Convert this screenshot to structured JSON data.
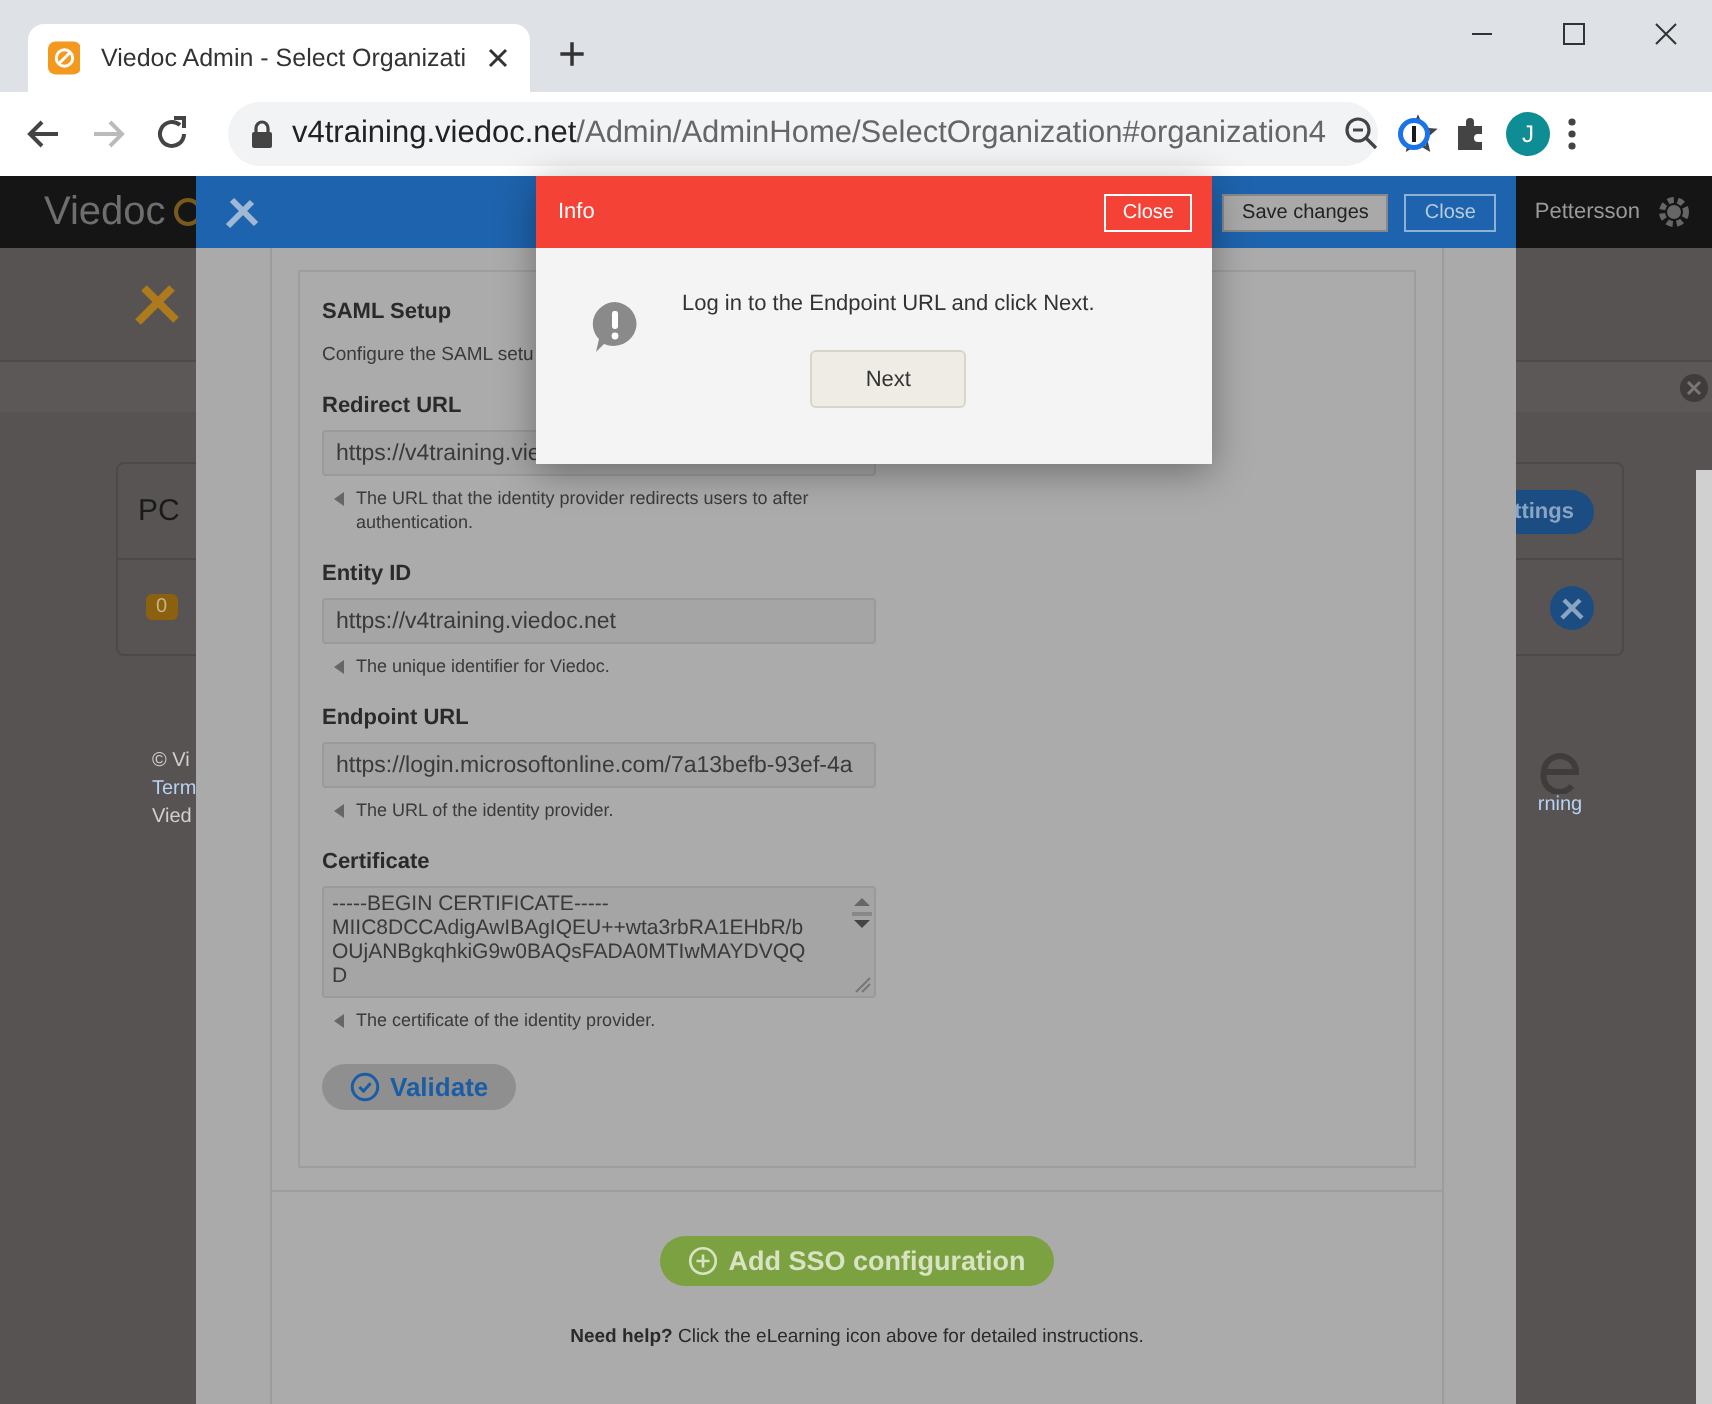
{
  "browser": {
    "tab_title": "Viedoc Admin - Select Organizati",
    "new_tab": "+",
    "url_host": "v4training.viedoc.net",
    "url_path": "/Admin/AdminHome/SelectOrganization#organization4",
    "profile_initial": "J"
  },
  "app_bar": {
    "logo": "Viedoc",
    "user": "Pettersson"
  },
  "background": {
    "card_title": "PC",
    "badge": "0",
    "settings_button": "ttings",
    "footer_lines": [
      "© Vi",
      "Term",
      "Vied"
    ],
    "elearning_link": "rning"
  },
  "settings_modal": {
    "buttons": [
      {
        "label": "Save changes",
        "kind": "secondary"
      },
      {
        "label": "Close",
        "kind": "primary"
      }
    ],
    "section_title": "SAML Setup",
    "section_hint": "Configure the SAML setu",
    "fields": [
      {
        "label": "Redirect URL",
        "kind": "input",
        "value": "https://v4training.vie",
        "hint": "The URL that the identity provider redirects users to after authentication."
      },
      {
        "label": "Entity ID",
        "kind": "input",
        "value": "https://v4training.viedoc.net",
        "hint": "The unique identifier for Viedoc."
      },
      {
        "label": "Endpoint URL",
        "kind": "input",
        "value": "https://login.microsoftonline.com/7a13befb-93ef-4a",
        "hint": "The URL of the identity provider."
      },
      {
        "label": "Certificate",
        "kind": "textarea",
        "lines": [
          "-----BEGIN CERTIFICATE-----",
          "MIIC8DCCAdigAwIBAgIQEU++wta3rbRA1EHbR/b",
          "OUjANBgkqhkiG9w0BAQsFADA0MTIwMAYDVQQ",
          "D"
        ],
        "hint": "The certificate of the identity provider."
      }
    ],
    "validate_button": "Validate",
    "add_button": "Add SSO configuration",
    "help": "**Need help?** Click the eLearning icon above for detailed instructions."
  },
  "info_dialog": {
    "title": "Info",
    "close": "Close",
    "message": "Log in to the Endpoint URL and click Next.",
    "button": "Next"
  }
}
